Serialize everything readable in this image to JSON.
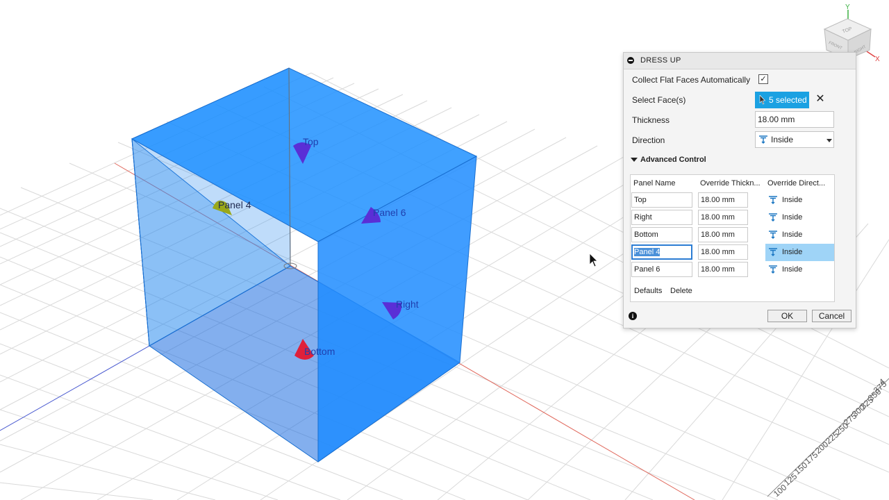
{
  "markers": [
    {
      "label": "Top",
      "color": "#5a2fd6"
    },
    {
      "label": "Panel 4",
      "color": "#9aa81a"
    },
    {
      "label": "Panel 6",
      "color": "#5a2fd6"
    },
    {
      "label": "Right",
      "color": "#5a2fd6"
    },
    {
      "label": "Bottom",
      "color": "#e0203a"
    }
  ],
  "ruler_labels": [
    "100",
    "125",
    "150",
    "175",
    "200",
    "225",
    "250",
    "275",
    "300",
    "325",
    "350",
    "375",
    "4"
  ],
  "viewcube": {
    "top": "TOP",
    "front": "FRONT",
    "right": "RIGHT",
    "axis_y": "Y",
    "axis_x": "X"
  },
  "dialog": {
    "title": "DRESS UP",
    "collect_label": "Collect Flat Faces Automatically",
    "collect_checked": "✓",
    "select_label": "Select Face(s)",
    "select_value": "5 selected",
    "clear_symbol": "✕",
    "thickness_label": "Thickness",
    "thickness_value": "18.00 mm",
    "direction_label": "Direction",
    "direction_value": "Inside",
    "advanced_label": "Advanced Control",
    "table": {
      "headers": [
        "Panel Name",
        "Override Thickn...",
        "Override Direct..."
      ],
      "rows": [
        {
          "name": "Top",
          "thickness": "18.00 mm",
          "direction": "Inside"
        },
        {
          "name": "Right",
          "thickness": "18.00 mm",
          "direction": "Inside"
        },
        {
          "name": "Bottom",
          "thickness": "18.00 mm",
          "direction": "Inside"
        },
        {
          "name": "Panel 4",
          "thickness": "18.00 mm",
          "direction": "Inside"
        },
        {
          "name": "Panel 6",
          "thickness": "18.00 mm",
          "direction": "Inside"
        }
      ]
    },
    "defaults_label": "Defaults",
    "delete_label": "Delete",
    "info_symbol": "i",
    "ok_label": "OK",
    "cancel_label": "Cancel"
  },
  "colors": {
    "accent": "#1ba1e2",
    "box": "#1e88f0",
    "selection": "#9fd4f7"
  }
}
